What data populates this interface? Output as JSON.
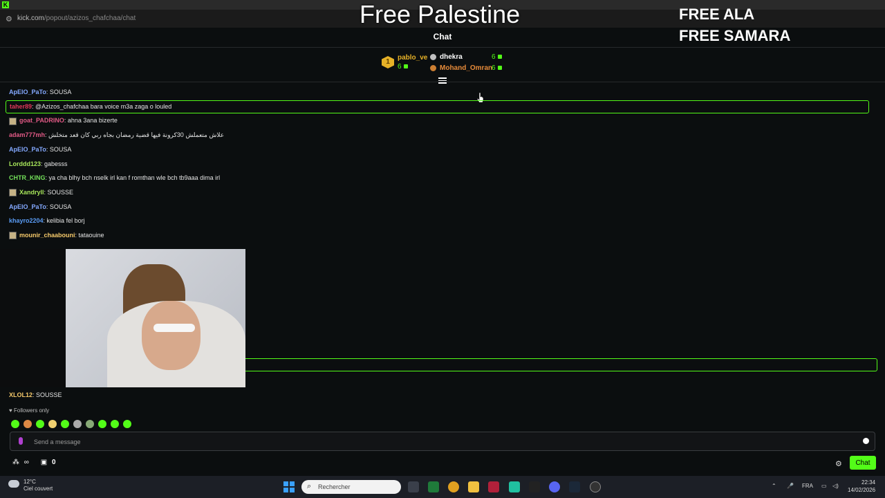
{
  "browser": {
    "sites_icon": "tune-icon",
    "url_domain": "kick.com",
    "url_path": "/popout/azizos_chafchaa/chat"
  },
  "overlay": {
    "title": "Free Palestine",
    "line1": "FREE ALA",
    "line2": "FREE SAMARA"
  },
  "chat_header": "Chat",
  "leaderboard": {
    "first": {
      "rank": "1",
      "name": "pablo_ve",
      "count": "6"
    },
    "second": {
      "name": "dhekra",
      "count": "6"
    },
    "third": {
      "name": "Mohand_Omran",
      "count": "6"
    }
  },
  "messages": [
    {
      "user": "ApEIO_PaTo",
      "text": ": SOUSA",
      "color": "#84a9ff"
    },
    {
      "user": "taher89",
      "text": ": @Azizos_chafchaa bara voice m3a zaga o louled",
      "color": "#e0385a",
      "highlight": true
    },
    {
      "user": "goat_PADRINO",
      "text": ": ahna 3ana bizerte",
      "color": "#e25a86",
      "avatar": true
    },
    {
      "user": "adam777mh",
      "text": ": علاش متعملش 30كرونة فيها قضية رمضان بجاه ربي كان قعد متخلش",
      "color": "#e25a86"
    },
    {
      "user": "ApEIO_PaTo",
      "text": ": SOUSA",
      "color": "#84a9ff"
    },
    {
      "user": "Lorddd123",
      "text": ": gabesss",
      "color": "#a7e55a"
    },
    {
      "user": "CHTR_KING",
      "text": ": ya cha blhy bch nselk irl kan f romthan wle bch tb9aaa dima irl",
      "color": "#74e15a"
    },
    {
      "user": "Xandryll",
      "text": ": SOUSSE",
      "color": "#a7e55a",
      "avatar": true
    },
    {
      "user": "ApEIO_PaTo",
      "text": ": SOUSA",
      "color": "#84a9ff"
    },
    {
      "user": "khayro2204",
      "text": ": kelibia fel borj",
      "color": "#5a9cf5"
    },
    {
      "user": "mounir_chaabouni",
      "text": ": tataouine",
      "color": "#f5c96a",
      "avatar": true
    }
  ],
  "last_message": {
    "user": "XLOL12",
    "text": ": SOUSSE",
    "color": "#f5c96a"
  },
  "followers_only": "Followers only",
  "input_placeholder": "Send a message",
  "bottom": {
    "count": "0",
    "chat_button": "Chat"
  },
  "taskbar": {
    "temp": "12°C",
    "weather": "Ciel couvert",
    "search": "Rechercher",
    "lang": "FRA",
    "time": "22:34",
    "date": "14/02/2026"
  },
  "accent": "#53fc18"
}
